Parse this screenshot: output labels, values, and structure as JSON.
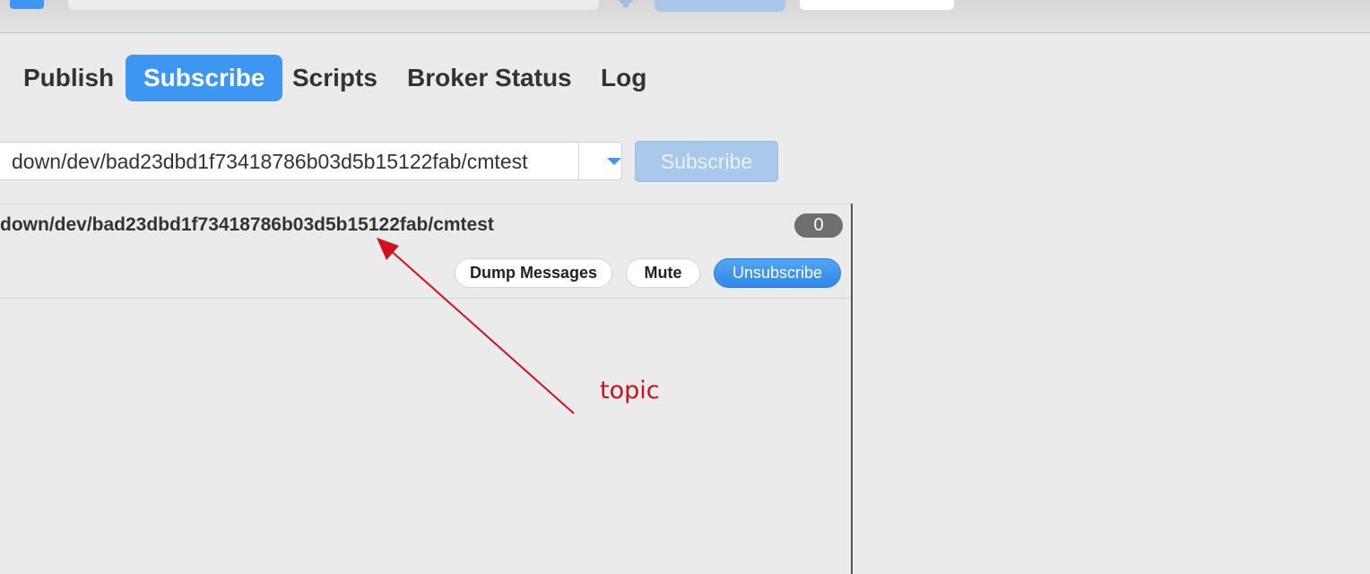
{
  "tabs": [
    {
      "label": "Publish",
      "active": false
    },
    {
      "label": "Subscribe",
      "active": true
    },
    {
      "label": "Scripts",
      "active": false
    },
    {
      "label": "Broker Status",
      "active": false
    },
    {
      "label": "Log",
      "active": false
    }
  ],
  "subscribe_bar": {
    "topic_value": "down/dev/bad23dbd1f73418786b03d5b15122fab/cmtest",
    "subscribe_label": "Subscribe"
  },
  "subscription": {
    "topic": "down/dev/bad23dbd1f73418786b03d5b15122fab/cmtest",
    "message_count": "0",
    "dump_label": "Dump Messages",
    "mute_label": "Mute",
    "unsubscribe_label": "Unsubscribe"
  },
  "annotation": {
    "label": "topic",
    "color": "#c8101e"
  },
  "colors": {
    "accent": "#3d97f2",
    "background": "#ebebeb",
    "badge": "#6f6f6f"
  }
}
